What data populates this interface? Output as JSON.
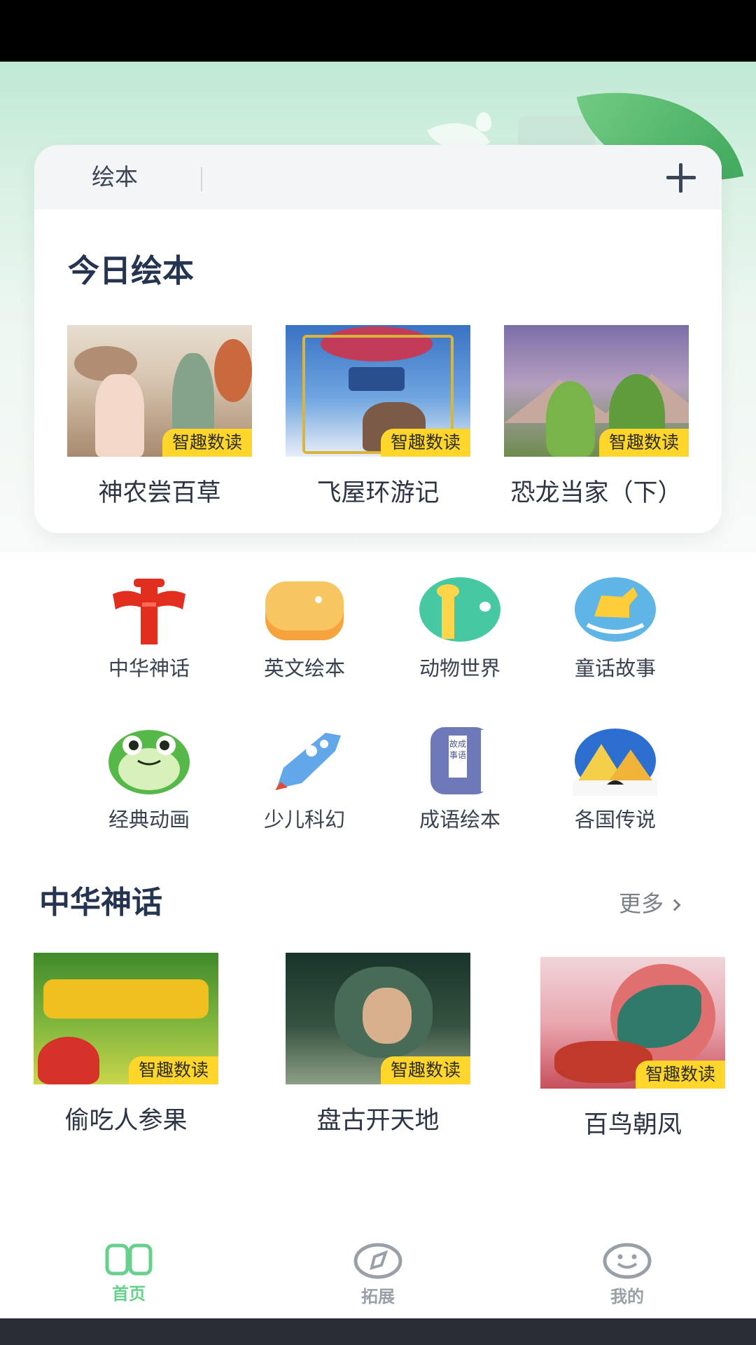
{
  "card": {
    "tab_label": "绘本",
    "add_button": "+",
    "title": "今日绘本",
    "books": [
      {
        "title": "神农尝百草",
        "badge": "智趣数读"
      },
      {
        "title": "飞屋环游记",
        "badge": "智趣数读"
      },
      {
        "title": "恐龙当家（下）",
        "badge": "智趣数读"
      }
    ]
  },
  "categories": [
    {
      "label": "中华神话",
      "icon": "torii-gate-icon"
    },
    {
      "label": "英文绘本",
      "icon": "orange-book-icon"
    },
    {
      "label": "动物世界",
      "icon": "giraffe-icon"
    },
    {
      "label": "童话故事",
      "icon": "rocking-horse-icon"
    },
    {
      "label": "经典动画",
      "icon": "frog-icon"
    },
    {
      "label": "少儿科幻",
      "icon": "rocket-icon"
    },
    {
      "label": "成语绘本",
      "icon": "idiom-book-icon"
    },
    {
      "label": "各国传说",
      "icon": "pyramid-icon"
    }
  ],
  "category_icon_text": "成语故事",
  "section": {
    "title": "中华神话",
    "more": "更多",
    "books": [
      {
        "title": "偷吃人参果",
        "badge": "智趣数读"
      },
      {
        "title": "盘古开天地",
        "badge": "智趣数读"
      },
      {
        "title": "百鸟朝凤",
        "badge": "智趣数读"
      }
    ]
  },
  "nav": {
    "items": [
      {
        "label": "首页",
        "icon": "open-book-icon",
        "active": true
      },
      {
        "label": "拓展",
        "icon": "compass-icon",
        "active": false
      },
      {
        "label": "我的",
        "icon": "smiley-icon",
        "active": false
      }
    ],
    "active_color": "#66d08c",
    "inactive_color": "#9aa0a8"
  },
  "colors": {
    "badge": "#ffd629",
    "title_text": "#253450",
    "status_bar": "#000000"
  }
}
